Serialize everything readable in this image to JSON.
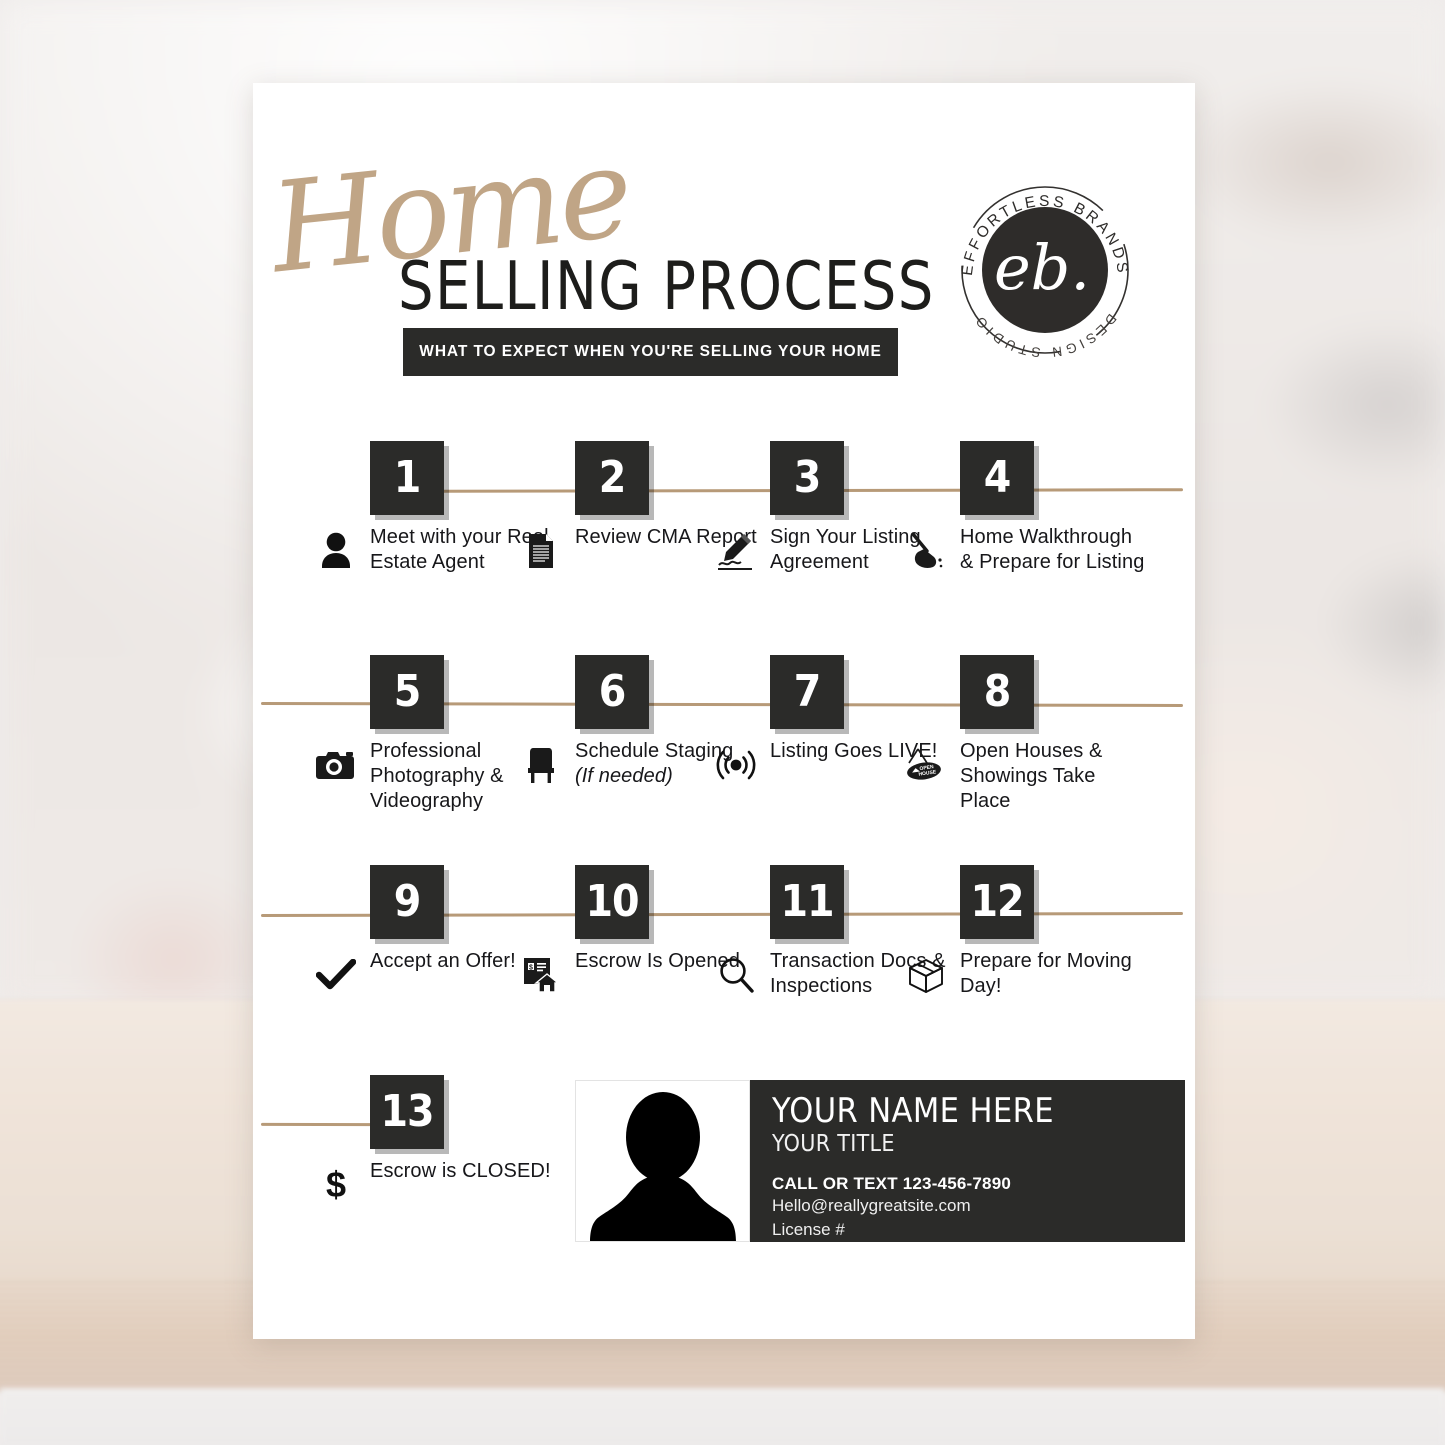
{
  "flyer": {
    "title_script": "Home",
    "title_main": "SELLING PROCESS",
    "subtitle": "WHAT TO EXPECT WHEN YOU'RE SELLING YOUR HOME"
  },
  "logo": {
    "monogram": "eb.",
    "top_text": "EFFORTLESS BRANDS",
    "bottom_text": "DESIGN STUDIO"
  },
  "colors": {
    "script_tan": "#c0a586",
    "connector_line": "#b79a78",
    "dark": "#2b2b29",
    "paper": "#ffffff"
  },
  "steps": [
    {
      "number": "1",
      "label": "Meet with your Real Estate Agent",
      "icon": "person-icon"
    },
    {
      "number": "2",
      "label": "Review CMA Report",
      "icon": "document-icon"
    },
    {
      "number": "3",
      "label": "Sign Your Listing Agreement",
      "icon": "signature-pen-icon"
    },
    {
      "number": "4",
      "label": "Home Walkthrough & Prepare for Listing",
      "icon": "broom-icon"
    },
    {
      "number": "5",
      "label": "Professional Photography & Videography",
      "icon": "camera-icon"
    },
    {
      "number": "6",
      "label": "Schedule Staging",
      "label_italic": "(If needed)",
      "icon": "chair-icon"
    },
    {
      "number": "7",
      "label": "Listing Goes LIVE!",
      "icon": "broadcast-icon"
    },
    {
      "number": "8",
      "label": "Open Houses & Showings Take Place",
      "icon": "open-house-sign-icon"
    },
    {
      "number": "9",
      "label": "Accept an Offer!",
      "icon": "checkmark-icon"
    },
    {
      "number": "10",
      "label": "Escrow Is Opened",
      "icon": "escrow-house-icon"
    },
    {
      "number": "11",
      "label": "Transaction Docs & Inspections",
      "icon": "magnifier-icon"
    },
    {
      "number": "12",
      "label": "Prepare for Moving Day!",
      "icon": "moving-box-icon"
    },
    {
      "number": "13",
      "label": "Escrow is CLOSED!",
      "icon": "dollar-sign-icon"
    }
  ],
  "contact": {
    "photo_icon": "avatar-silhouette-icon",
    "name": "YOUR NAME HERE",
    "title": "YOUR TITLE",
    "phone": "CALL OR TEXT 123-456-7890",
    "email": "Hello@reallygreatsite.com",
    "license": "License #"
  }
}
